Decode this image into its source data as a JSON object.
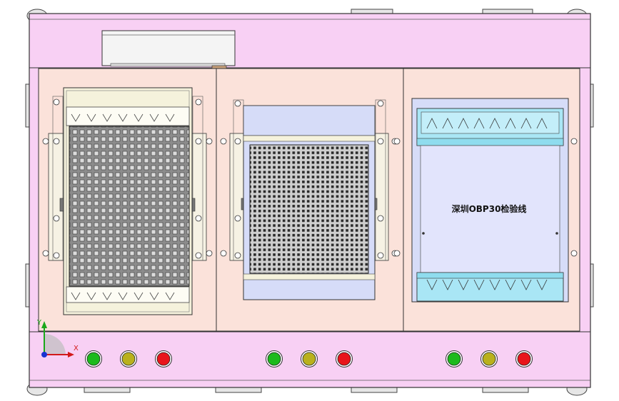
{
  "panel_label": "深圳OBP30检验线",
  "axis": {
    "x": "X",
    "y": "Y"
  },
  "colors": {
    "frame": "#f8d0f4",
    "bay": "#fbe2da",
    "gray_fixture": "#8c8c8c",
    "lavender": "#d6dcf8",
    "cyan": "#a9e6f5",
    "cream": "#f5f2dc",
    "btn_green": "#1cba1c",
    "btn_yellow": "#b9b11c",
    "btn_red": "#e8151b"
  },
  "button_groups": [
    [
      "green",
      "yellow",
      "red"
    ],
    [
      "green",
      "yellow",
      "red"
    ],
    [
      "green",
      "yellow",
      "red"
    ]
  ]
}
